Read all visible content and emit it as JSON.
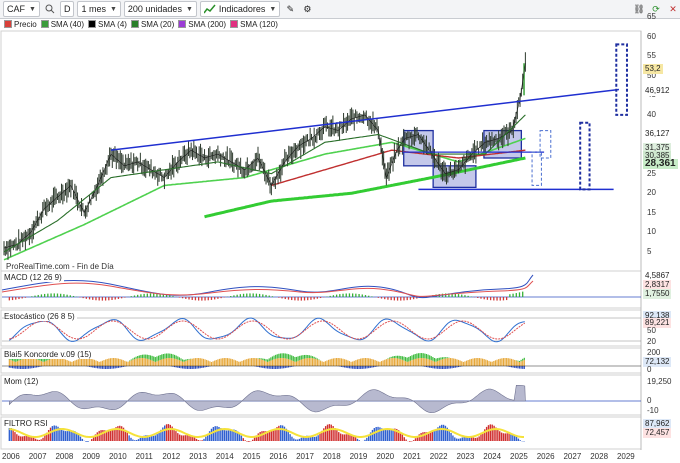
{
  "toolbar": {
    "ticker": "CAF",
    "chart_type": "D",
    "period": "1 mes",
    "units": "200 unidades",
    "indicators_label": "Indicadores"
  },
  "legend": {
    "items": [
      {
        "label": "Precio",
        "color": "#d8403a"
      },
      {
        "label": "SMA (40)",
        "color": "#3c9b3c"
      },
      {
        "label": "SMA (4)",
        "color": "#000000"
      },
      {
        "label": "SMA (20)",
        "color": "#2a7f2a"
      },
      {
        "label": "SMA (200)",
        "color": "#9c3cd6"
      },
      {
        "label": "SMA (120)",
        "color": "#e03080"
      }
    ]
  },
  "main": {
    "watermark": "ProRealTime.com - Fin de Día",
    "y_ticks": [
      "65",
      "60",
      "55",
      "50",
      "45",
      "40",
      "35",
      "30",
      "25",
      "20",
      "15",
      "10",
      "5"
    ],
    "price_tags": [
      {
        "text": "53,2",
        "bg": "#f6e7a3"
      },
      {
        "text": "46,912",
        "bg": "#ffffff"
      },
      {
        "text": "36,127",
        "bg": "#ffffff"
      },
      {
        "text": "31,375",
        "bg": "#ddeedd"
      },
      {
        "text": "30,385",
        "bg": "#cfe8cf"
      },
      {
        "text": "28,361",
        "bg": "#c8ecc8"
      }
    ]
  },
  "panels": {
    "macd": {
      "label": "MACD (12 26 9)",
      "tags": [
        "4,5867",
        "2,8317",
        "1,7550"
      ]
    },
    "stoch": {
      "label": "Estocástico (26 8 5)",
      "ticks": [
        "80",
        "50",
        "20"
      ],
      "tags": [
        "92,138",
        "89,221"
      ]
    },
    "blai5": {
      "label": "Blai5 Koncorde v.09 (15)",
      "ticks": [
        "200",
        "0"
      ],
      "tags": [
        "72,132"
      ]
    },
    "mom": {
      "label": "Mom (12)",
      "ticks": [
        "19,250",
        "0",
        "-10"
      ]
    },
    "rsi": {
      "label": "FILTRO RSI",
      "tags": [
        "87,962",
        "72,457"
      ]
    }
  },
  "x_axis": {
    "years": [
      "2006",
      "2007",
      "2008",
      "2009",
      "2010",
      "2011",
      "2012",
      "2013",
      "2014",
      "2015",
      "2016",
      "2017",
      "2018",
      "2019",
      "2020",
      "2021",
      "2022",
      "2023",
      "2024",
      "2025",
      "2026",
      "2027",
      "2028",
      "2029"
    ]
  },
  "chart_data": {
    "type": "line",
    "ylim": [
      5,
      65
    ],
    "price_points": [
      [
        2006.0,
        6
      ],
      [
        2006.5,
        7
      ],
      [
        2007.0,
        10
      ],
      [
        2007.5,
        16
      ],
      [
        2008.0,
        19
      ],
      [
        2008.5,
        22
      ],
      [
        2009.0,
        15
      ],
      [
        2009.5,
        22
      ],
      [
        2010.0,
        30
      ],
      [
        2010.5,
        27
      ],
      [
        2011.0,
        28
      ],
      [
        2011.5,
        26
      ],
      [
        2012.0,
        24
      ],
      [
        2012.5,
        28
      ],
      [
        2013.0,
        31
      ],
      [
        2013.5,
        29
      ],
      [
        2014.0,
        30
      ],
      [
        2014.5,
        28
      ],
      [
        2015.0,
        26
      ],
      [
        2015.5,
        29
      ],
      [
        2016.0,
        22
      ],
      [
        2016.5,
        28
      ],
      [
        2017.0,
        32
      ],
      [
        2017.5,
        34
      ],
      [
        2018.0,
        37
      ],
      [
        2018.5,
        36
      ],
      [
        2019.0,
        39
      ],
      [
        2019.5,
        40
      ],
      [
        2020.0,
        36
      ],
      [
        2020.3,
        24
      ],
      [
        2020.7,
        31
      ],
      [
        2021.0,
        34
      ],
      [
        2021.5,
        35
      ],
      [
        2022.0,
        30
      ],
      [
        2022.5,
        25
      ],
      [
        2023.0,
        26
      ],
      [
        2023.5,
        30
      ],
      [
        2024.0,
        33
      ],
      [
        2024.5,
        34
      ],
      [
        2025.0,
        36
      ],
      [
        2025.3,
        44
      ],
      [
        2025.5,
        53.2
      ]
    ],
    "resistance_line": [
      [
        2010.0,
        31
      ],
      [
        2029.0,
        46.5
      ]
    ],
    "support_line": [
      [
        2021.5,
        21
      ],
      [
        2028.8,
        21
      ]
    ],
    "sma40": [
      [
        2006.0,
        3
      ],
      [
        2009.0,
        12
      ],
      [
        2012.0,
        22
      ],
      [
        2015.0,
        24
      ],
      [
        2018.0,
        30
      ],
      [
        2020.5,
        33
      ],
      [
        2023.0,
        28
      ],
      [
        2025.5,
        34
      ]
    ],
    "sma200": [
      [
        2013.5,
        14
      ],
      [
        2016.0,
        18
      ],
      [
        2019.0,
        20
      ],
      [
        2022.0,
        24
      ],
      [
        2025.5,
        29
      ]
    ],
    "sma120": [
      [
        2016.0,
        22
      ],
      [
        2019.0,
        28
      ],
      [
        2020.5,
        31
      ],
      [
        2023.0,
        29
      ],
      [
        2025.5,
        31
      ]
    ]
  }
}
